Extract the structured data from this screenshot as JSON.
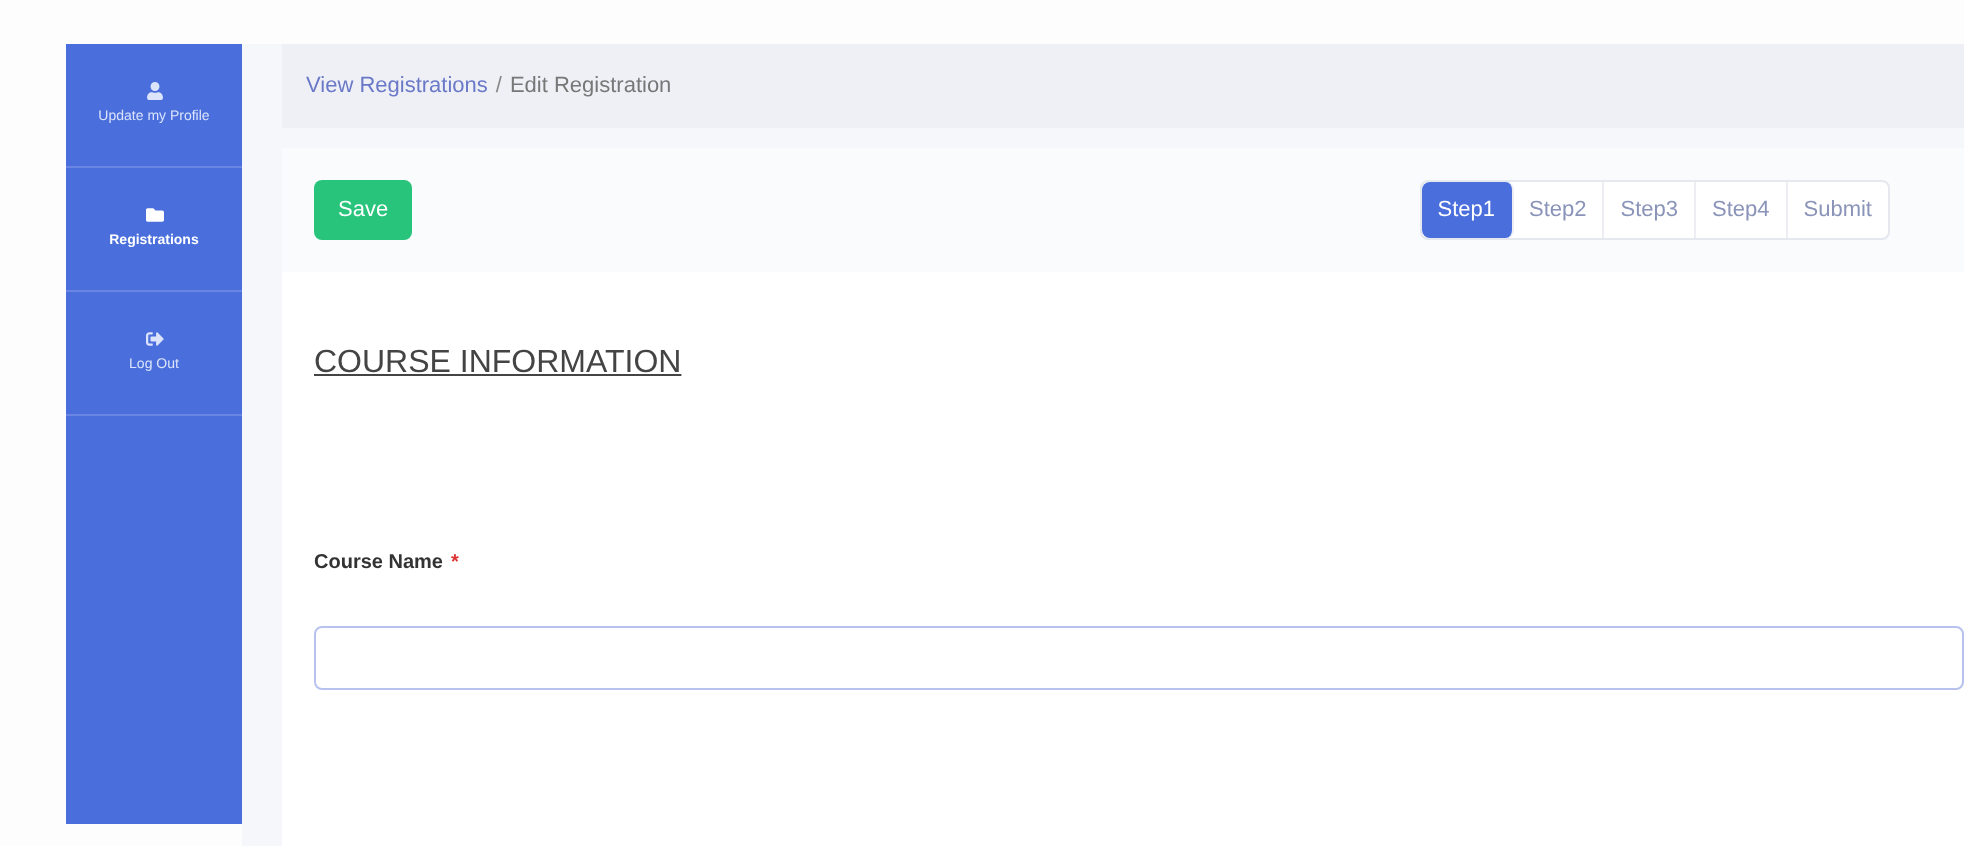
{
  "sidebar": {
    "items": [
      {
        "kind": "user",
        "label": "Update my Profile",
        "selected": false
      },
      {
        "kind": "folder",
        "label": "Registrations",
        "selected": true
      },
      {
        "kind": "logout",
        "label": "Log Out",
        "selected": false
      }
    ]
  },
  "breadcrumb": {
    "link": "View Registrations",
    "separator": "/",
    "current": "Edit Registration"
  },
  "save_button": "Save",
  "steps": [
    {
      "label": "Step1",
      "selected": true
    },
    {
      "label": "Step2",
      "selected": false
    },
    {
      "label": "Step3",
      "selected": false
    },
    {
      "label": "Step4",
      "selected": false
    },
    {
      "label": "Submit",
      "selected": false
    }
  ],
  "section_title": "COURSE INFORMATION",
  "field": {
    "label": "Course Name",
    "required_mark": "*"
  }
}
